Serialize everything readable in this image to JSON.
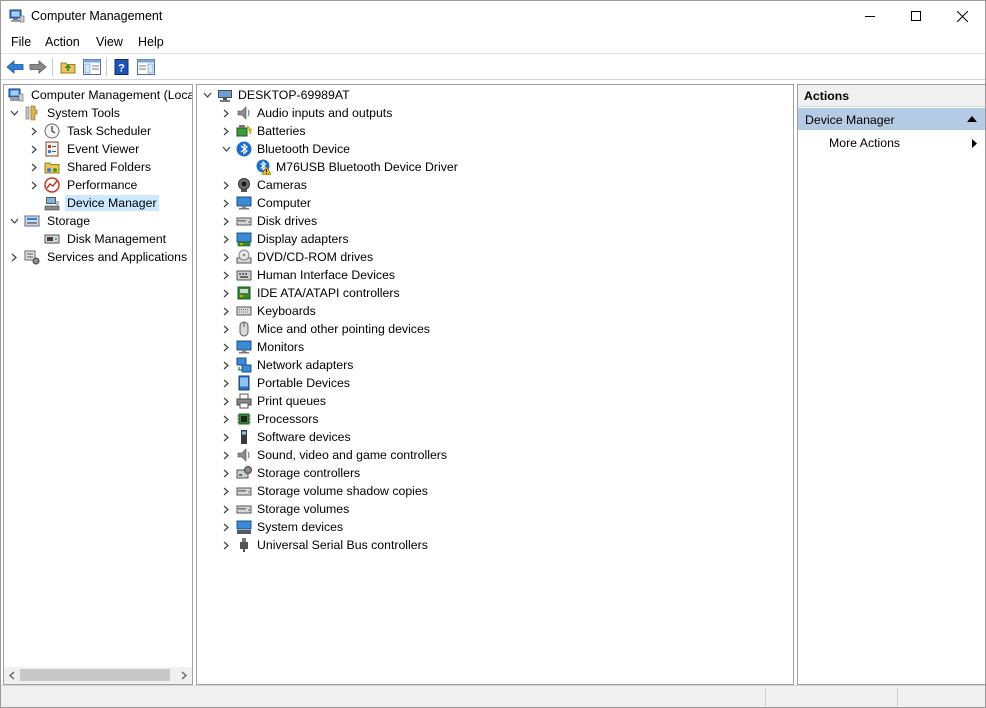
{
  "window": {
    "title": "Computer Management"
  },
  "menu": [
    "File",
    "Action",
    "View",
    "Help"
  ],
  "toolbar": [
    "back-icon",
    "forward-icon",
    "up-folder-icon",
    "show-hide-console-tree-icon",
    "help-icon",
    "show-hide-action-pane-icon"
  ],
  "left_tree": [
    {
      "label": "Computer Management (Local",
      "level": 0,
      "expander": "none",
      "icon": "computer-management-icon"
    },
    {
      "label": "System Tools",
      "level": 1,
      "expander": "expanded",
      "icon": "tools-icon"
    },
    {
      "label": "Task Scheduler",
      "level": 2,
      "expander": "collapsed",
      "icon": "clock-icon"
    },
    {
      "label": "Event Viewer",
      "level": 2,
      "expander": "collapsed",
      "icon": "event-viewer-icon"
    },
    {
      "label": "Shared Folders",
      "level": 2,
      "expander": "collapsed",
      "icon": "shared-folder-icon"
    },
    {
      "label": "Performance",
      "level": 2,
      "expander": "collapsed",
      "icon": "performance-icon"
    },
    {
      "label": "Device Manager",
      "level": 2,
      "expander": "none",
      "icon": "device-manager-icon",
      "selected": true
    },
    {
      "label": "Storage",
      "level": 1,
      "expander": "expanded",
      "icon": "storage-icon"
    },
    {
      "label": "Disk Management",
      "level": 2,
      "expander": "none",
      "icon": "disk-icon"
    },
    {
      "label": "Services and Applications",
      "level": 1,
      "expander": "collapsed",
      "icon": "services-icon"
    }
  ],
  "device_tree": {
    "root": "DESKTOP-69989AT",
    "items": [
      {
        "label": "Audio inputs and outputs",
        "icon": "speaker-icon",
        "expander": "collapsed"
      },
      {
        "label": "Batteries",
        "icon": "battery-icon",
        "expander": "collapsed"
      },
      {
        "label": "Bluetooth Device",
        "icon": "bluetooth-icon",
        "expander": "expanded"
      },
      {
        "label": "M76USB Bluetooth Device Driver",
        "icon": "bluetooth-warning-icon",
        "expander": "none",
        "child": true
      },
      {
        "label": "Cameras",
        "icon": "camera-icon",
        "expander": "collapsed"
      },
      {
        "label": "Computer",
        "icon": "monitor-icon",
        "expander": "collapsed"
      },
      {
        "label": "Disk drives",
        "icon": "disk-drive-icon",
        "expander": "collapsed"
      },
      {
        "label": "Display adapters",
        "icon": "display-adapter-icon",
        "expander": "collapsed"
      },
      {
        "label": "DVD/CD-ROM drives",
        "icon": "dvd-icon",
        "expander": "collapsed"
      },
      {
        "label": "Human Interface Devices",
        "icon": "hid-icon",
        "expander": "collapsed"
      },
      {
        "label": "IDE ATA/ATAPI controllers",
        "icon": "ide-icon",
        "expander": "collapsed"
      },
      {
        "label": "Keyboards",
        "icon": "keyboard-icon",
        "expander": "collapsed"
      },
      {
        "label": "Mice and other pointing devices",
        "icon": "mouse-icon",
        "expander": "collapsed"
      },
      {
        "label": "Monitors",
        "icon": "monitor-icon",
        "expander": "collapsed"
      },
      {
        "label": "Network adapters",
        "icon": "network-icon",
        "expander": "collapsed"
      },
      {
        "label": "Portable Devices",
        "icon": "portable-device-icon",
        "expander": "collapsed"
      },
      {
        "label": "Print queues",
        "icon": "printer-icon",
        "expander": "collapsed"
      },
      {
        "label": "Processors",
        "icon": "processor-icon",
        "expander": "collapsed"
      },
      {
        "label": "Software devices",
        "icon": "software-device-icon",
        "expander": "collapsed"
      },
      {
        "label": "Sound, video and game controllers",
        "icon": "speaker-icon",
        "expander": "collapsed"
      },
      {
        "label": "Storage controllers",
        "icon": "storage-controller-icon",
        "expander": "collapsed"
      },
      {
        "label": "Storage volume shadow copies",
        "icon": "disk-drive-icon",
        "expander": "collapsed"
      },
      {
        "label": "Storage volumes",
        "icon": "disk-drive-icon",
        "expander": "collapsed"
      },
      {
        "label": "System devices",
        "icon": "system-device-icon",
        "expander": "collapsed"
      },
      {
        "label": "Universal Serial Bus controllers",
        "icon": "usb-icon",
        "expander": "collapsed"
      }
    ]
  },
  "actions": {
    "header": "Actions",
    "section": "Device Manager",
    "items": [
      "More Actions"
    ]
  },
  "colors": {
    "selection": "#cce8ff",
    "actions_section": "#b4cbe3",
    "accent_blue": "#1e6ec8"
  }
}
